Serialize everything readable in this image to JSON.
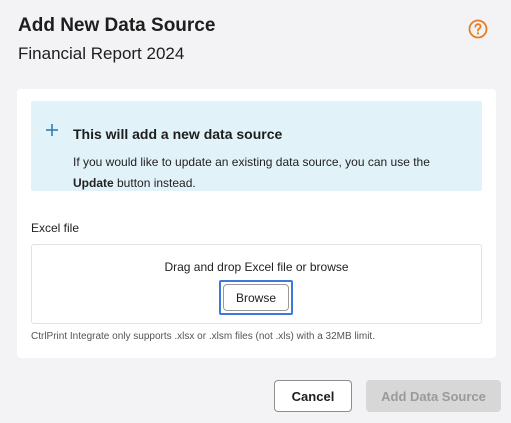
{
  "dialog": {
    "title": "Add New Data Source",
    "subtitle": "Financial Report 2024",
    "help_icon": "help-circle-icon"
  },
  "info": {
    "icon": "plus-icon",
    "title": "This will add a new data source",
    "text_before": "If you would like to update an existing data source, you can use the ",
    "text_bold": "Update",
    "text_after": " button instead."
  },
  "excel_field": {
    "label": "Excel file",
    "drop_text": "Drag and drop Excel file or browse",
    "browse_label": "Browse",
    "hint": "CtrlPrint Integrate only supports .xlsx or .xlsm files (not .xls) with a 32MB limit."
  },
  "footer": {
    "cancel_label": "Cancel",
    "add_label": "Add Data Source"
  },
  "colors": {
    "accent": "#3b7ad9",
    "help_icon": "#e87c1e",
    "info_background": "#e2f2f9",
    "disabled_button": "#d7d7d7"
  }
}
